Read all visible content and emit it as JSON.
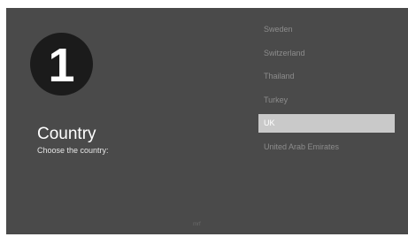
{
  "step": {
    "number": "1"
  },
  "section": {
    "title": "Country",
    "subtitle": "Choose the country:"
  },
  "countries": [
    {
      "label": "Sweden",
      "selected": false
    },
    {
      "label": "Switzerland",
      "selected": false
    },
    {
      "label": "Thailand",
      "selected": false
    },
    {
      "label": "Turkey",
      "selected": false
    },
    {
      "label": "UK",
      "selected": true
    },
    {
      "label": "United Arab Emirates",
      "selected": false
    }
  ],
  "colors": {
    "screen_background": "#4a4a4a",
    "step_circle": "#1b1b1b",
    "selected_highlight": "#c9c9c9",
    "unselected_text": "#8c8c8c"
  },
  "footer": {
    "mark": "mrf"
  }
}
